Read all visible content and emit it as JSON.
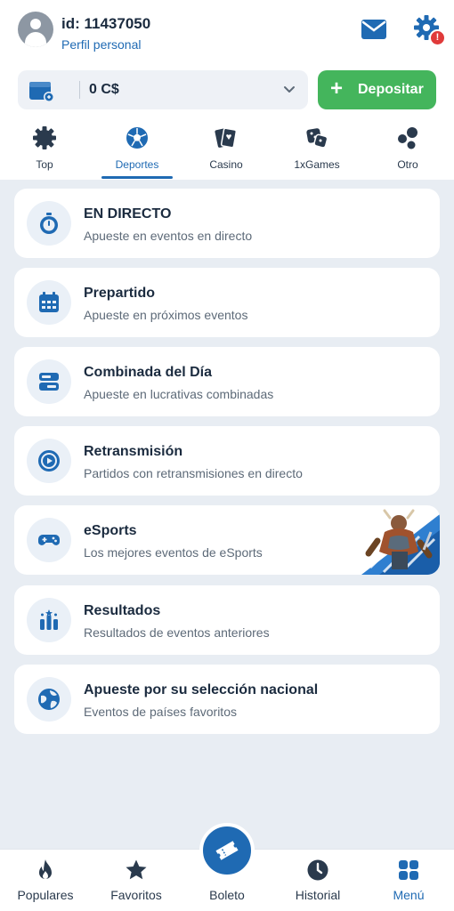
{
  "header": {
    "user_id": "id: 11437050",
    "profile_link": "Perfil personal",
    "alert_badge": "!",
    "balance": "0 C$",
    "deposit_label": "Depositar"
  },
  "tabs": [
    {
      "label": "Top",
      "icon": "gear-badge-icon"
    },
    {
      "label": "Deportes",
      "icon": "soccer-ball-icon",
      "active": true
    },
    {
      "label": "Casino",
      "icon": "cards-icon"
    },
    {
      "label": "1xGames",
      "icon": "dice-icon"
    },
    {
      "label": "Otro",
      "icon": "bubbles-icon"
    }
  ],
  "cards": [
    {
      "title": "EN DIRECTO",
      "subtitle": "Apueste en eventos en directo",
      "icon": "stopwatch-icon"
    },
    {
      "title": "Prepartido",
      "subtitle": "Apueste en próximos eventos",
      "icon": "calendar-icon"
    },
    {
      "title": "Combinada del Día",
      "subtitle": "Apueste en lucrativas combinadas",
      "icon": "combo-icon"
    },
    {
      "title": "Retransmisión",
      "subtitle": "Partidos con retransmisiones en directo",
      "icon": "play-circle-icon"
    },
    {
      "title": "eSports",
      "subtitle": "Los mejores eventos de eSports",
      "icon": "gamepad-icon"
    },
    {
      "title": "Resultados",
      "subtitle": "Resultados de eventos anteriores",
      "icon": "results-icon"
    },
    {
      "title": "Apueste por su selección nacional",
      "subtitle": "Eventos de países favoritos",
      "icon": "globe-icon"
    }
  ],
  "bottom_nav": [
    {
      "label": "Populares",
      "icon": "flame-icon"
    },
    {
      "label": "Favoritos",
      "icon": "star-icon"
    },
    {
      "label": "Boleto",
      "icon": "ticket-icon"
    },
    {
      "label": "Historial",
      "icon": "clock-icon"
    },
    {
      "label": "Menú",
      "icon": "grid-icon",
      "active": true
    }
  ],
  "colors": {
    "accent": "#1f6ab3",
    "deposit": "#44b55c",
    "background": "#e8edf3",
    "alert": "#e03a3a"
  }
}
